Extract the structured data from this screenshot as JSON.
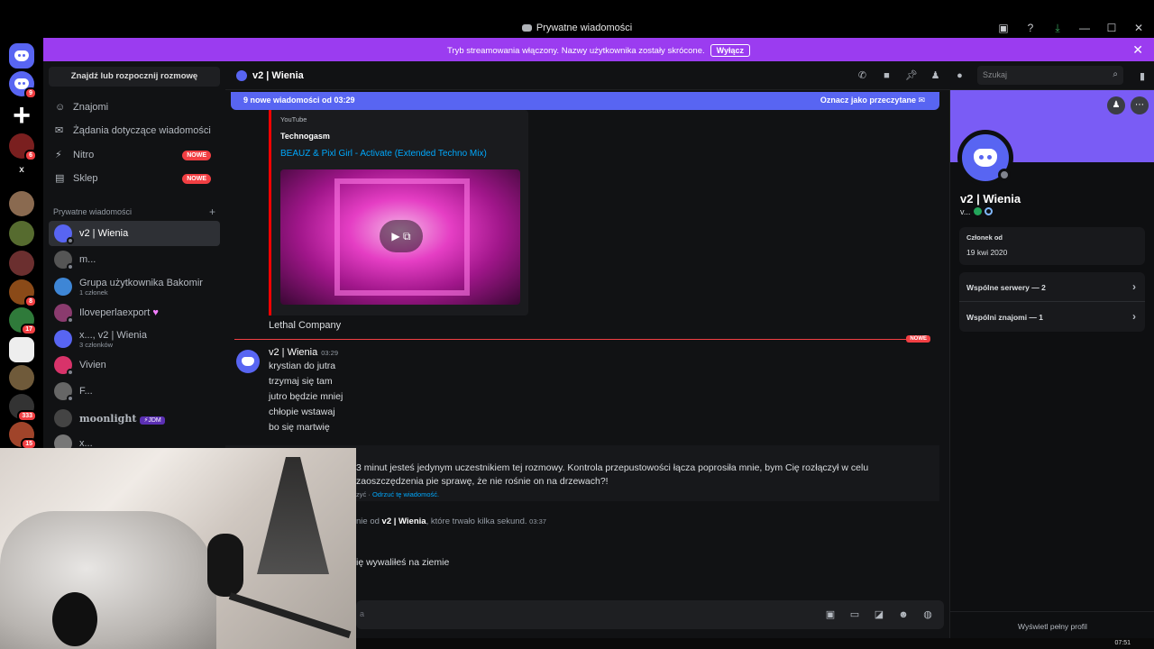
{
  "window": {
    "title": "Prywatne wiadomości"
  },
  "streamer_banner": {
    "text": "Tryb streamowania włączony. Nazwy użytkownika zostały skrócone.",
    "button": "Wyłącz",
    "color": "#9b3cf0"
  },
  "rail": {
    "home_badge": "9",
    "badges": [
      "6",
      "8",
      "17",
      "333",
      "15"
    ],
    "x_label": "x"
  },
  "sidebar": {
    "finder": "Znajdź lub rozpocznij rozmowę",
    "nav": [
      {
        "label": "Znajomi",
        "icon": "friends-icon"
      },
      {
        "label": "Żądania dotyczące wiadomości",
        "icon": "mail-icon"
      },
      {
        "label": "Nitro",
        "icon": "nitro-icon",
        "badge": "NOWE"
      },
      {
        "label": "Sklep",
        "icon": "shop-icon",
        "badge": "NOWE"
      }
    ],
    "dm_header": "Prywatne wiadomości",
    "dms": [
      {
        "name": "v2 | Wienia",
        "sub": "",
        "color": "#5865f2"
      },
      {
        "name": "m...",
        "sub": "",
        "color": "#555"
      },
      {
        "name": "Grupa użytkownika Bakomir",
        "sub": "1 członek",
        "color": "#3e86d6"
      },
      {
        "name": "Iloveperlaexport",
        "sub": "",
        "color": "#8a3b6e"
      },
      {
        "name": "x..., v2 | Wienia",
        "sub": "3 członków",
        "color": "#5865f2"
      },
      {
        "name": "Vivien",
        "sub": "",
        "color": "#d8336a"
      },
      {
        "name": "F...",
        "sub": "",
        "color": "#666"
      },
      {
        "name": "moonlight",
        "sub": "",
        "tag": "JDM",
        "color": "#444"
      },
      {
        "name": "x...",
        "sub": "",
        "color": "#777"
      }
    ]
  },
  "chat_header": {
    "name": "v2 | Wienia",
    "search_placeholder": "Szukaj"
  },
  "chat": {
    "new_messages": "9 nowe wiadomości od 03:29",
    "mark_read": "Oznacz jako przeczytane",
    "embed": {
      "provider": "YouTube",
      "author": "Technogasm",
      "title": "BEAUZ & Pixl Girl - Activate (Extended Techno Mix)"
    },
    "prev_line": "Lethal Company",
    "divider_badge": "NOWE",
    "message": {
      "author": "v2 | Wienia",
      "time": "03:29",
      "lines": [
        "krystian do jutra",
        "trzymaj się tam",
        "jutro będzie mniej",
        "chłopie wstawaj",
        "bo się martwię"
      ]
    },
    "system": {
      "text": "3 minut jesteś jedynym uczestnikiem tej rozmowy. Kontrola przepustowości łącza poprosiła mnie, bym Cię rozłączył w celu zaoszczędzenia pie sprawę, że nie rośnie on na drzewach?!",
      "action_prefix": "zyć ·",
      "action_link": "Odrzuć tę wiadomość."
    },
    "call": {
      "prefix": "nie od",
      "name": "v2 | Wienia",
      "suffix": ", które trwało kilka sekund.",
      "time": "03:37"
    },
    "last_line": "ię wywaliłeś na ziemie",
    "composer_placeholder": "a"
  },
  "profile": {
    "name": "v2 | Wienia",
    "username": "v...",
    "member_since_label": "Członek od",
    "member_since": "19 kwi 2020",
    "mutual_servers": "Wspólne serwery — 2",
    "mutual_friends": "Wspólni znajomi — 1",
    "full_profile": "Wyświetl pełny profil",
    "banner_color": "#7a5cf5"
  },
  "taskbar": {
    "clock": "07:51"
  }
}
